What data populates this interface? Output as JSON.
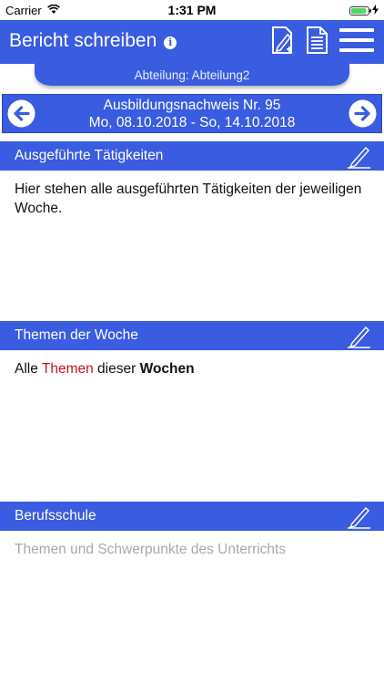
{
  "status_bar": {
    "carrier": "Carrier",
    "time": "1:31 PM",
    "battery_level": 0.9
  },
  "navbar": {
    "title": "Bericht schreiben",
    "info_icon": "info-icon",
    "actions": [
      "new-report-icon",
      "document-icon",
      "menu-icon"
    ]
  },
  "department": {
    "label": "Abteilung: Abteilung2"
  },
  "week": {
    "title": "Ausbildungsnachweis Nr. 95",
    "range": "Mo, 08.10.2018 - So, 14.10.2018"
  },
  "sections": {
    "activities": {
      "title": "Ausgeführte Tätigkeiten",
      "content": "Hier stehen alle ausgeführten Tätigkeiten der jeweiligen Woche."
    },
    "topics": {
      "title": "Themen der Woche",
      "content_parts": [
        "Alle ",
        "Themen",
        " dieser ",
        "Wochen"
      ]
    },
    "school": {
      "title": "Berufsschule",
      "placeholder": "Themen und Schwerpunkte des Unterrichts"
    }
  },
  "colors": {
    "primary": "#3a5ce0",
    "highlight_red": "#c0151b",
    "placeholder": "#a8a8ae"
  }
}
